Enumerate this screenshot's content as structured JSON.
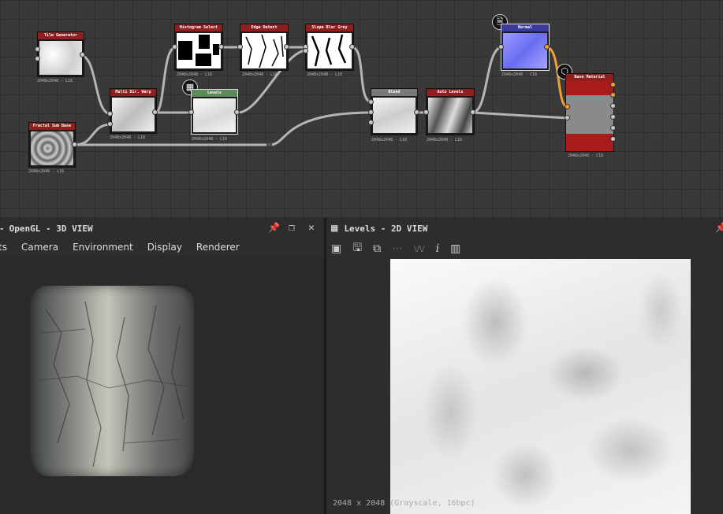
{
  "graph": {
    "nodes": [
      {
        "id": "tile_generator",
        "title": "Tile Generator",
        "res": "2048x2048 - L16",
        "header_color": "#8f1f1f"
      },
      {
        "id": "fractal_sum_base",
        "title": "Fractal Sum Base",
        "res": "2048x2048 - L16",
        "header_color": "#8f1f1f"
      },
      {
        "id": "multi_dir_warp",
        "title": "Multi Dir. Warp",
        "res": "2048x2048 - L16",
        "header_color": "#8f1f1f"
      },
      {
        "id": "histogram_select",
        "title": "Histogram Select",
        "res": "2048x2048 - L16",
        "header_color": "#8f1f1f"
      },
      {
        "id": "levels",
        "title": "Levels",
        "res": "2048x2048 - L16",
        "header_color": "#5d8a5a"
      },
      {
        "id": "edge_detect",
        "title": "Edge Detect",
        "res": "2048x2048 - L16",
        "header_color": "#8f1f1f"
      },
      {
        "id": "slope_blur_grey",
        "title": "Slope Blur Grey",
        "res": "2048x2048 - L16",
        "header_color": "#8f1f1f"
      },
      {
        "id": "blend",
        "title": "Blend",
        "res": "2048x2048 - L16",
        "header_color": "#7a7a7a"
      },
      {
        "id": "auto_levels",
        "title": "Auto Levels",
        "res": "2048x2048 - L16",
        "header_color": "#8f1f1f"
      },
      {
        "id": "normal",
        "title": "Normal",
        "res": "2048x2048 - C16",
        "header_color": "#3a3a9a"
      },
      {
        "id": "base_material",
        "title": "Base Material",
        "res": "2048x2048 - C16",
        "header_color": "#8f1f1f"
      }
    ]
  },
  "view3d": {
    "title": "OpenGL - 3D VIEW",
    "title_prefix": "-",
    "menu": [
      "ts",
      "Camera",
      "Environment",
      "Display",
      "Renderer"
    ]
  },
  "view2d": {
    "title": "Levels - 2D VIEW",
    "status": "2048 x 2048 (Grayscale, 16bpc)",
    "toolbar_icons": [
      "export-icon",
      "save-icon",
      "copy-icon",
      "graph-icon",
      "view-mode-icon",
      "info-icon",
      "histogram-icon"
    ],
    "toolbar_glyphs": [
      "▣",
      "🖫",
      "⧉",
      "⋯",
      "\\/\\/",
      "i",
      "▥"
    ]
  },
  "icons": {
    "pin": "📌",
    "maximize": "❐",
    "close": "✕",
    "document": "🗎",
    "cube": "⬡",
    "checker": "▦"
  },
  "colors": {
    "accent_orange": "#f0a030",
    "node_red": "#8f1f1f",
    "node_green": "#5d8a5a",
    "node_blue": "#3a3a9a"
  }
}
